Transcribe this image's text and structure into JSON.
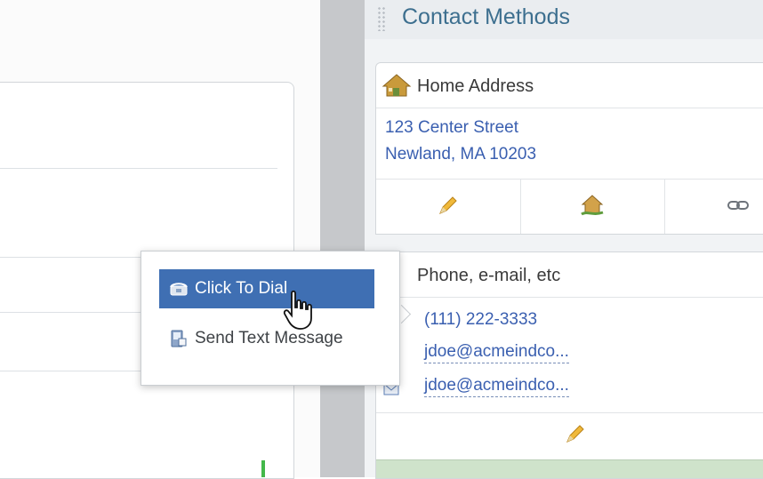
{
  "panel": {
    "title": "Contact Methods"
  },
  "address_card": {
    "title": "Home Address",
    "line1": "123 Center Street",
    "line2": "Newland, MA 10203",
    "actions": [
      {
        "icon": "pencil-icon"
      },
      {
        "icon": "house-map-icon"
      },
      {
        "icon": "link-icon"
      }
    ]
  },
  "phone_card": {
    "title": "Phone, e-mail, etc",
    "phone": "(111) 222-3333",
    "email1": "jdoe@acmeindco...",
    "email2": "jdoe@acmeindco...",
    "actions": [
      {
        "icon": "pencil-icon"
      }
    ]
  },
  "popup_menu": {
    "items": [
      {
        "label": "Click To Dial",
        "icon": "telephone-icon",
        "selected": true
      },
      {
        "label": "Send Text Message",
        "icon": "sms-device-icon",
        "selected": false
      }
    ]
  },
  "colors": {
    "accent": "#3f6fb3",
    "link": "#3a5fb0",
    "title": "#3d6f8f",
    "footer_green": "#cfe3cb"
  }
}
